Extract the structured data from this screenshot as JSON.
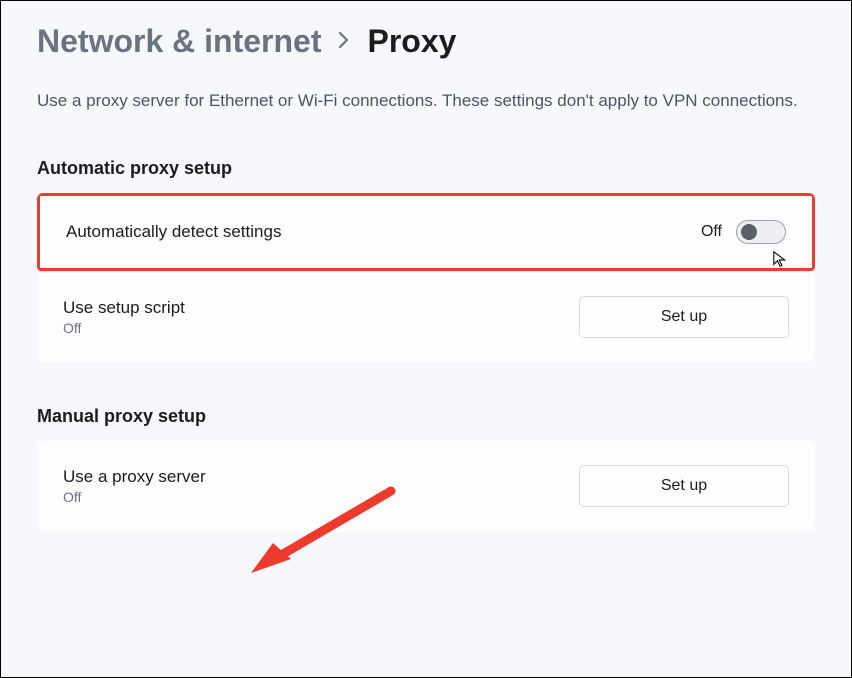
{
  "breadcrumb": {
    "parent": "Network & internet",
    "current": "Proxy"
  },
  "description": "Use a proxy server for Ethernet or Wi-Fi connections. These settings don't apply to VPN connections.",
  "sections": {
    "automatic": {
      "heading": "Automatic proxy setup",
      "detect": {
        "label": "Automatically detect settings",
        "state": "Off"
      },
      "script": {
        "label": "Use setup script",
        "state": "Off",
        "button": "Set up"
      }
    },
    "manual": {
      "heading": "Manual proxy setup",
      "proxy": {
        "label": "Use a proxy server",
        "state": "Off",
        "button": "Set up"
      }
    }
  }
}
